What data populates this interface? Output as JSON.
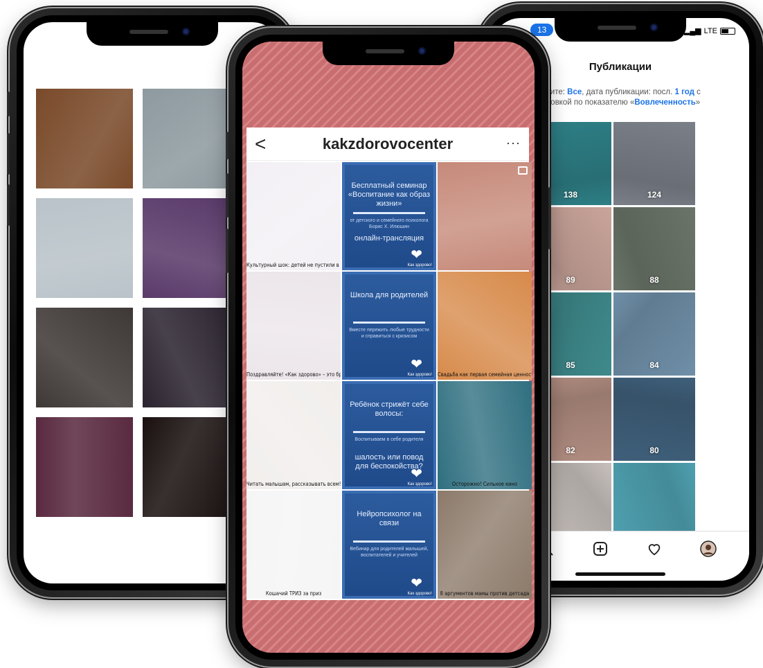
{
  "left_phone": {
    "tiles": [
      {
        "name": "steak-dinner-photo",
        "bg": "#7a4a2a"
      },
      {
        "name": "couple-street-photo",
        "bg": "#8e9aa0"
      },
      {
        "name": "braided-hair-photo",
        "bg": "#b9c3c9"
      },
      {
        "name": "couple-selfie-photo",
        "bg": "#5a3a6a"
      },
      {
        "name": "woman-sitting-photo",
        "bg": "#3e3836"
      },
      {
        "name": "tv-cartoon-photo",
        "bg": "#2b2430"
      },
      {
        "name": "chocolate-gifts-photo",
        "bg": "#5a2a40"
      },
      {
        "name": "night-lights-photo",
        "bg": "#1a1010"
      }
    ]
  },
  "right_phone": {
    "status": {
      "badge": "13",
      "network": "LTE"
    },
    "title": "Публикации",
    "filter": {
      "prefix": "дите: ",
      "all": "Все",
      "middle": ", дата публикации: посл. ",
      "period": "1 год",
      "suffix": " с",
      "line2_prefix": "ровкой по показателю «",
      "metric": "Вовлеченность",
      "line2_suffix": "»"
    },
    "tiles": [
      {
        "name": "ship-photo",
        "bg": "#4a6a78",
        "count": ""
      },
      {
        "name": "sea-pier-photo",
        "bg": "#2e7f86",
        "count": "138"
      },
      {
        "name": "sunglasses-selfie",
        "bg": "#7a7f88",
        "count": "124"
      },
      {
        "name": "partial-portrait",
        "bg": "#8a6a5a",
        "count": ""
      },
      {
        "name": "woman-eyes-closed",
        "bg": "#c9a49a",
        "count": "89"
      },
      {
        "name": "car-interior",
        "bg": "#6a7468",
        "count": "88"
      },
      {
        "name": "beach-rocks",
        "bg": "#5a7788",
        "count": ""
      },
      {
        "name": "woman-on-stairs",
        "bg": "#3f8a8c",
        "count": "85"
      },
      {
        "name": "woman-on-tower",
        "bg": "#6f8fa8",
        "count": "84"
      },
      {
        "name": "partial-face",
        "bg": "#9a7a70",
        "count": ""
      },
      {
        "name": "selfie-closeup",
        "bg": "#b08c80",
        "count": "82"
      },
      {
        "name": "perfume-bottle",
        "bg": "#3f5f7a",
        "count": "80"
      },
      {
        "name": "flowers",
        "bg": "#6a9a6a",
        "count": ""
      },
      {
        "name": "face-glitter",
        "bg": "#c7c0bc",
        "count": ""
      },
      {
        "name": "hand-ring-sea",
        "bg": "#4fa0b0",
        "count": ""
      }
    ],
    "nav": [
      "search-icon",
      "add-post-icon",
      "heart-icon",
      "profile-avatar"
    ]
  },
  "center_phone": {
    "username": "kakzdorovocenter",
    "back": "<",
    "more": "···",
    "tiles": [
      {
        "type": "photo",
        "name": "ballerina-watercolor",
        "bg": "#f3f0f5",
        "caption": "Культурный шок: детей не пустили в Большой театр"
      },
      {
        "type": "card",
        "name": "seminar-card",
        "title": "Бесплатный семинар «Воспитание как образ жизни»",
        "sub": "от детского и семейного психолога Борис Х. Илюшин",
        "title2": "онлайн-трансляция",
        "brand": "Как здорово!"
      },
      {
        "type": "photo",
        "name": "child-with-toys",
        "bg": "#c68a7a",
        "caption": ""
      },
      {
        "type": "photo",
        "name": "candles-decor",
        "bg": "#ece6ea",
        "caption": "Поздравляйте! «Как здорово» – это бренд!"
      },
      {
        "type": "card",
        "name": "parents-school-card",
        "title": "Школа для родителей",
        "sub": "Вместе пережить любые трудности и справиться с кризисом",
        "title2": "",
        "brand": "Как здорово!"
      },
      {
        "type": "photo",
        "name": "wedding-sunset",
        "bg": "#d78a4a",
        "caption": "Свадьба как первая семейная ценность?"
      },
      {
        "type": "photo",
        "name": "family-figurine",
        "bg": "#f1eeec",
        "caption": "Читать малышам, рассказывать всем!"
      },
      {
        "type": "card",
        "name": "haircut-card",
        "title": "Ребёнок стрижёт себе волосы:",
        "sub": "Воспитываем в себе родителя",
        "title2": "шалость или повод для беспокойства?",
        "brand": "Как здорово!"
      },
      {
        "type": "photo",
        "name": "retro-tv",
        "bg": "#2f6f80",
        "caption": "Осторожно! Сильное кино"
      },
      {
        "type": "photo",
        "name": "cat-drawing",
        "bg": "#f5f5f5",
        "caption": "Кошачий ТРИЗ за приз"
      },
      {
        "type": "card",
        "name": "neuropsych-card",
        "title": "Нейропсихолог на связи",
        "sub": "Вебинар для родителей малышей, воспитателей и учителей",
        "title2": "",
        "brand": "Как здорово!"
      },
      {
        "type": "photo",
        "name": "kids-costumes",
        "bg": "#8c7a6a",
        "caption": "8 аргументов мамы против детсада"
      }
    ]
  }
}
